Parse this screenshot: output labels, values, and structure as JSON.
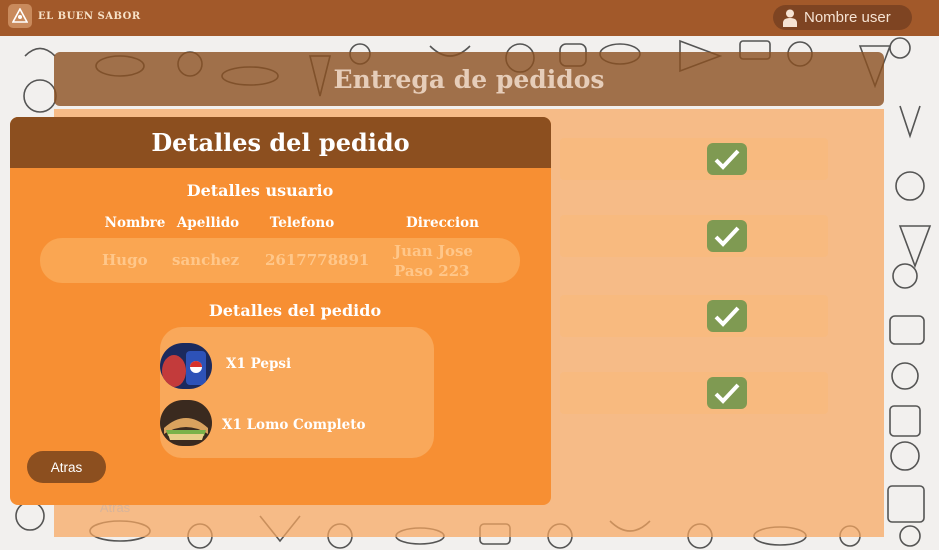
{
  "topbar": {
    "brand": "EL BUEN SABOR",
    "user_name": "Nombre user"
  },
  "background_page": {
    "title": "Entrega de pedidos",
    "back_label": "Atras"
  },
  "modal": {
    "title": "Detalles del pedido",
    "user_section_title": "Detalles usuario",
    "columns": [
      "Nombre",
      "Apellido",
      "Telefono",
      "Direccion"
    ],
    "user": {
      "nombre": "Hugo",
      "apellido": "sanchez",
      "telefono": "2617778891",
      "direccion_line1": "Juan Jose",
      "direccion_line2": "Paso 223"
    },
    "order_section_title": "Detalles del pedido",
    "items": [
      {
        "label": "X1 Pepsi",
        "icon": "pepsi-image"
      },
      {
        "label": "X1 Lomo Completo",
        "icon": "lomo-sandwich-image"
      }
    ],
    "back_label": "Atras"
  },
  "colors": {
    "topbar": "#a2592a",
    "modal": "#f78f33",
    "modal_header": "#8c4f1f",
    "check": "#7f9a52"
  }
}
